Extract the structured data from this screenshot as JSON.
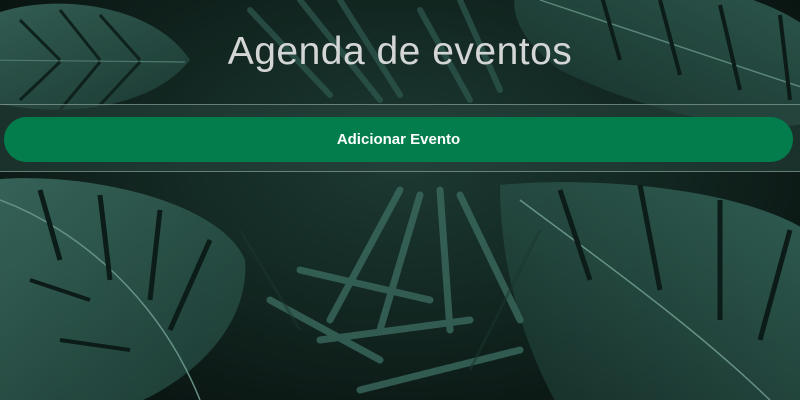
{
  "header": {
    "title": "Agenda de eventos"
  },
  "actions": {
    "add_event_label": "Adicionar Evento"
  },
  "colors": {
    "button_background": "#037d4c",
    "title_text": "#d4d6d5",
    "button_text": "#ffffff",
    "background_dark": "#0b1512",
    "leaf_green": "#2d5a50"
  }
}
